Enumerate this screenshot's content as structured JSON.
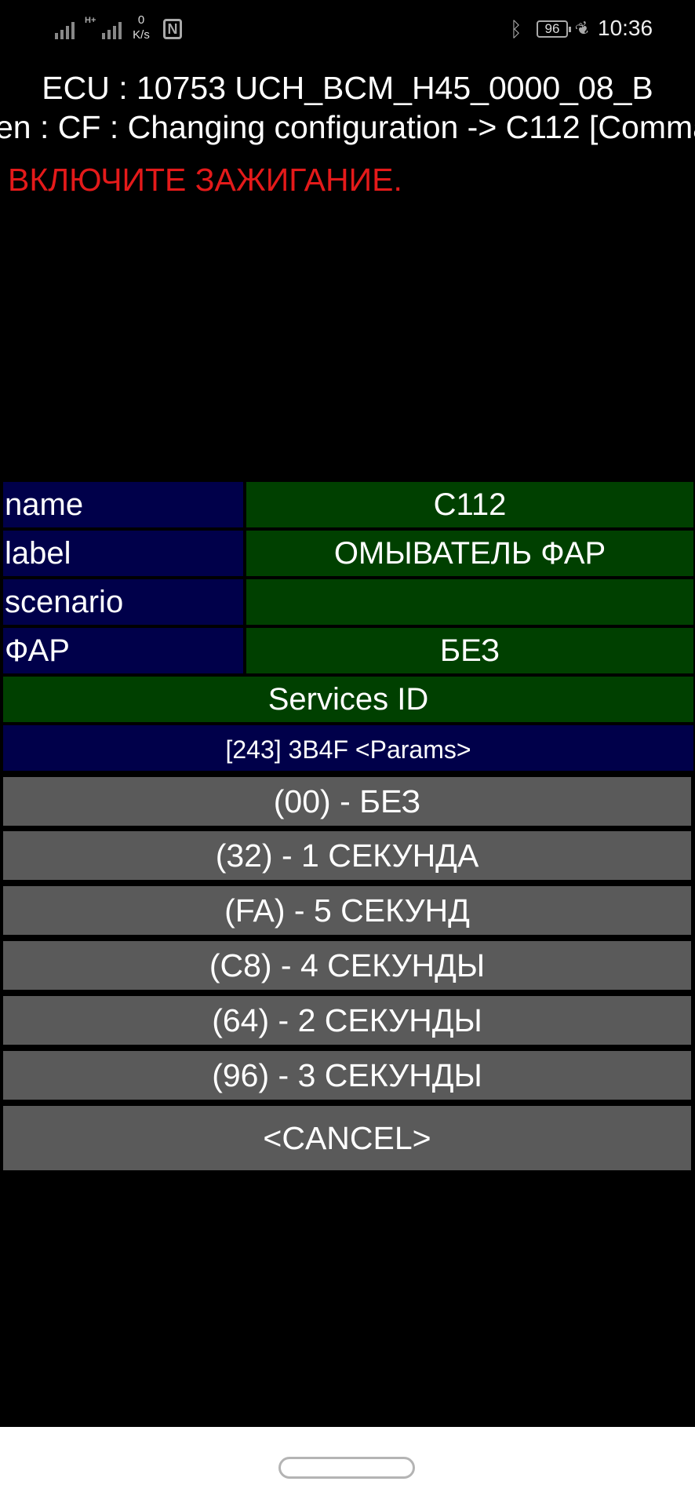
{
  "status_bar": {
    "network_speed_value": "0",
    "network_speed_unit": "K/s",
    "network_type": "H+",
    "battery_level": "96",
    "time": "10:36",
    "icons": [
      "signal-icon",
      "signal-icon",
      "nfc-icon",
      "bluetooth-icon",
      "battery-icon",
      "power-saving-leaf-icon"
    ]
  },
  "header": {
    "ecu_line": "ECU : 10753  UCH_BCM_H45_0000_08_B",
    "screen_line": "en : CF : Changing configuration -> C112 [Comma",
    "warning": "ВКЛЮЧИТЕ ЗАЖИГАНИЕ."
  },
  "details": {
    "rows": [
      {
        "key": "name",
        "value": "C112"
      },
      {
        "key": "label",
        "value": "ОМЫВАТЕЛЬ ФАР"
      },
      {
        "key": "scenario",
        "value": ""
      },
      {
        "key": "ФАР",
        "value": "БЕЗ"
      }
    ],
    "services_header": "Services ID",
    "params_header": "[243] 3B4F <Params>"
  },
  "options": [
    "(00) - БЕЗ",
    "(32) - 1 СЕКУНДА",
    "(FA) - 5 СЕКУНД",
    "(C8) - 4 СЕКУНДЫ",
    "(64) - 2 СЕКУНДЫ",
    "(96) - 3 СЕКУНДЫ"
  ],
  "cancel_label": "<CANCEL>",
  "colors": {
    "background": "#000000",
    "key_cell": "#00004a",
    "value_cell": "#004000",
    "option_button": "#5a5a5a",
    "warning_text": "#e41a1a"
  }
}
